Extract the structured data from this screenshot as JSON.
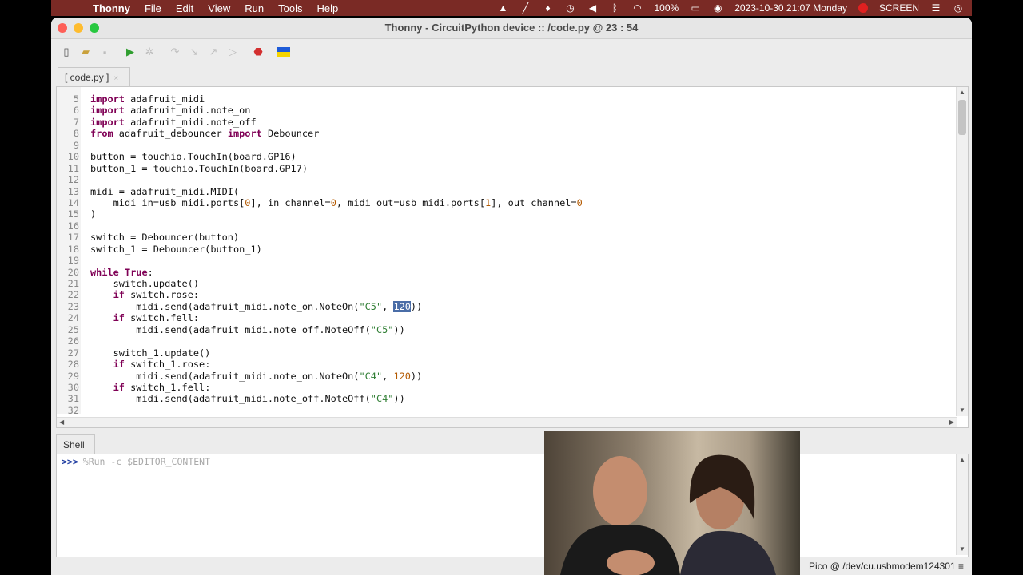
{
  "menubar": {
    "app": "Thonny",
    "items": [
      "File",
      "Edit",
      "View",
      "Run",
      "Tools",
      "Help"
    ],
    "battery": "100%",
    "datetime": "2023-10-30  21:07  Monday",
    "screen_label": "SCREEN"
  },
  "window": {
    "title": "Thonny  -  CircuitPython device :: /code.py  @  23 : 54"
  },
  "tabs": {
    "editor_tab": "[ code.py ]",
    "shell_tab": "Shell"
  },
  "code": {
    "lines": [
      {
        "n": "5"
      },
      {
        "n": "6"
      },
      {
        "n": "7"
      },
      {
        "n": "8"
      },
      {
        "n": "9"
      },
      {
        "n": "10"
      },
      {
        "n": "11"
      },
      {
        "n": "12"
      },
      {
        "n": "13"
      },
      {
        "n": "14"
      },
      {
        "n": "15"
      },
      {
        "n": "16"
      },
      {
        "n": "17"
      },
      {
        "n": "18"
      },
      {
        "n": "19"
      },
      {
        "n": "20"
      },
      {
        "n": "21"
      },
      {
        "n": "22"
      },
      {
        "n": "23"
      },
      {
        "n": "24"
      },
      {
        "n": "25"
      },
      {
        "n": "26"
      },
      {
        "n": "27"
      },
      {
        "n": "28"
      },
      {
        "n": "29"
      },
      {
        "n": "30"
      },
      {
        "n": "31"
      },
      {
        "n": "32"
      }
    ],
    "t": {
      "import": "import",
      "from": "from",
      "while": "while",
      "true": "True",
      "if": "if",
      "l5": " adafruit_midi",
      "l6": " adafruit_midi.note_on",
      "l7": " adafruit_midi.note_off",
      "l8a": " adafruit_debouncer ",
      "l8b": " Debouncer",
      "l10": "button = touchio.TouchIn(board.GP16)",
      "l11": "button_1 = touchio.TouchIn(board.GP17)",
      "l13": "midi = adafruit_midi.MIDI(",
      "l14a": "    midi_in=usb_midi.ports[",
      "l14n0": "0",
      "l14b": "], in_channel=",
      "l14c": ", midi_out=usb_midi.ports[",
      "l14n1": "1",
      "l14d": "], out_channel=",
      "l15": ")",
      "l17": "switch = Debouncer(button)",
      "l18": "switch_1 = Debouncer(button_1)",
      "l20": ":",
      "l21": "    switch.update()",
      "l22": " switch.rose:",
      "l23a": "        midi.send(adafruit_midi.note_on.NoteOn(",
      "l23s": "\"C5\"",
      "l23b": ", ",
      "l23n": "120",
      "l23c": "))",
      "l24": " switch.fell:",
      "l25a": "        midi.send(adafruit_midi.note_off.NoteOff(",
      "l25s": "\"C5\"",
      "l25b": "))",
      "l27": "    switch_1.update()",
      "l28": " switch_1.rose:",
      "l29a": "        midi.send(adafruit_midi.note_on.NoteOn(",
      "l29s": "\"C4\"",
      "l29b": ", ",
      "l29n": "120",
      "l29c": "))",
      "l30": " switch_1.fell:",
      "l31a": "        midi.send(adafruit_midi.note_off.NoteOff(",
      "l31s": "\"C4\"",
      "l31b": "))"
    }
  },
  "shell": {
    "prompt": ">>>",
    "command": "%Run -c $EDITOR_CONTENT"
  },
  "status": "Pico @ /dev/cu.usbmodem124301  ≡"
}
